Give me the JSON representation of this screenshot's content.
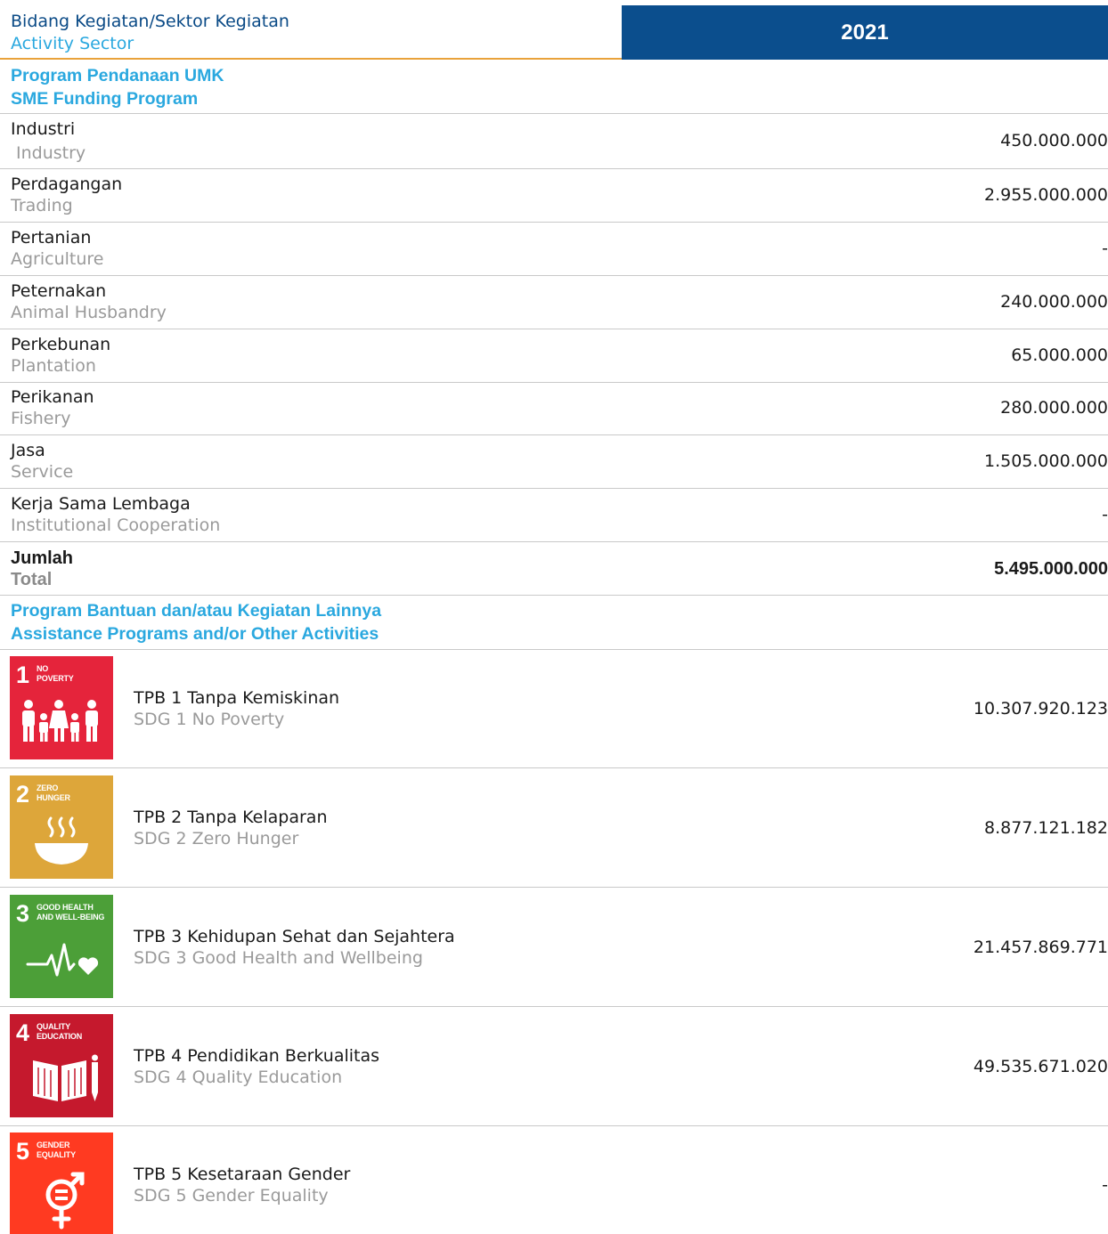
{
  "header": {
    "title_id": "Bidang Kegiatan/Sektor Kegiatan",
    "title_en": "Activity Sector",
    "year": "2021"
  },
  "section1": {
    "title_id": "Program Pendanaan UMK",
    "title_en": "SME Funding Program"
  },
  "rows": [
    {
      "id": "Industri",
      "en": "Industry",
      "value": "450.000.000"
    },
    {
      "id": "Perdagangan",
      "en": "Trading",
      "value": "2.955.000.000"
    },
    {
      "id": "Pertanian",
      "en": "Agriculture",
      "value": "-"
    },
    {
      "id": "Peternakan",
      "en": "Animal Husbandry",
      "value": "240.000.000"
    },
    {
      "id": "Perkebunan",
      "en": "Plantation",
      "value": "65.000.000"
    },
    {
      "id": "Perikanan",
      "en": "Fishery",
      "value": "280.000.000"
    },
    {
      "id": "Jasa",
      "en": "Service",
      "value": "1.505.000.000"
    },
    {
      "id": "Kerja Sama Lembaga",
      "en": "Institutional Cooperation",
      "value": "-"
    }
  ],
  "total": {
    "id": "Jumlah",
    "en": "Total",
    "value": "5.495.000.000"
  },
  "section2": {
    "title_id": "Program Bantuan dan/atau Kegiatan Lainnya",
    "title_en": "Assistance Programs and/or Other Activities"
  },
  "sdgs": [
    {
      "num": "1",
      "label": "NO\nPOVERTY",
      "icon": "family-icon",
      "color": "#e5243b",
      "id": "TPB 1 Tanpa Kemiskinan",
      "en": "SDG 1 No Poverty",
      "value": "10.307.920.123"
    },
    {
      "num": "2",
      "label": "ZERO\nHUNGER",
      "icon": "bowl-icon",
      "color": "#dda63a",
      "id": "TPB 2 Tanpa Kelaparan",
      "en": "SDG 2 Zero Hunger",
      "value": "8.877.121.182"
    },
    {
      "num": "3",
      "label": "GOOD HEALTH\nAND WELL-BEING",
      "icon": "heartbeat-icon",
      "color": "#4c9f38",
      "id": "TPB 3 Kehidupan Sehat dan Sejahtera",
      "en": "SDG 3 Good Health and Wellbeing",
      "value": "21.457.869.771"
    },
    {
      "num": "4",
      "label": "QUALITY\nEDUCATION",
      "icon": "book-pencil-icon",
      "color": "#c5192d",
      "id": "TPB 4 Pendidikan Berkualitas",
      "en": "SDG 4 Quality Education",
      "value": "49.535.671.020"
    },
    {
      "num": "5",
      "label": "GENDER\nEQUALITY",
      "icon": "gender-symbol-icon",
      "color": "#ff3a21",
      "id": "TPB 5 Kesetaraan Gender",
      "en": "SDG 5 Gender Equality",
      "value": "-"
    }
  ]
}
